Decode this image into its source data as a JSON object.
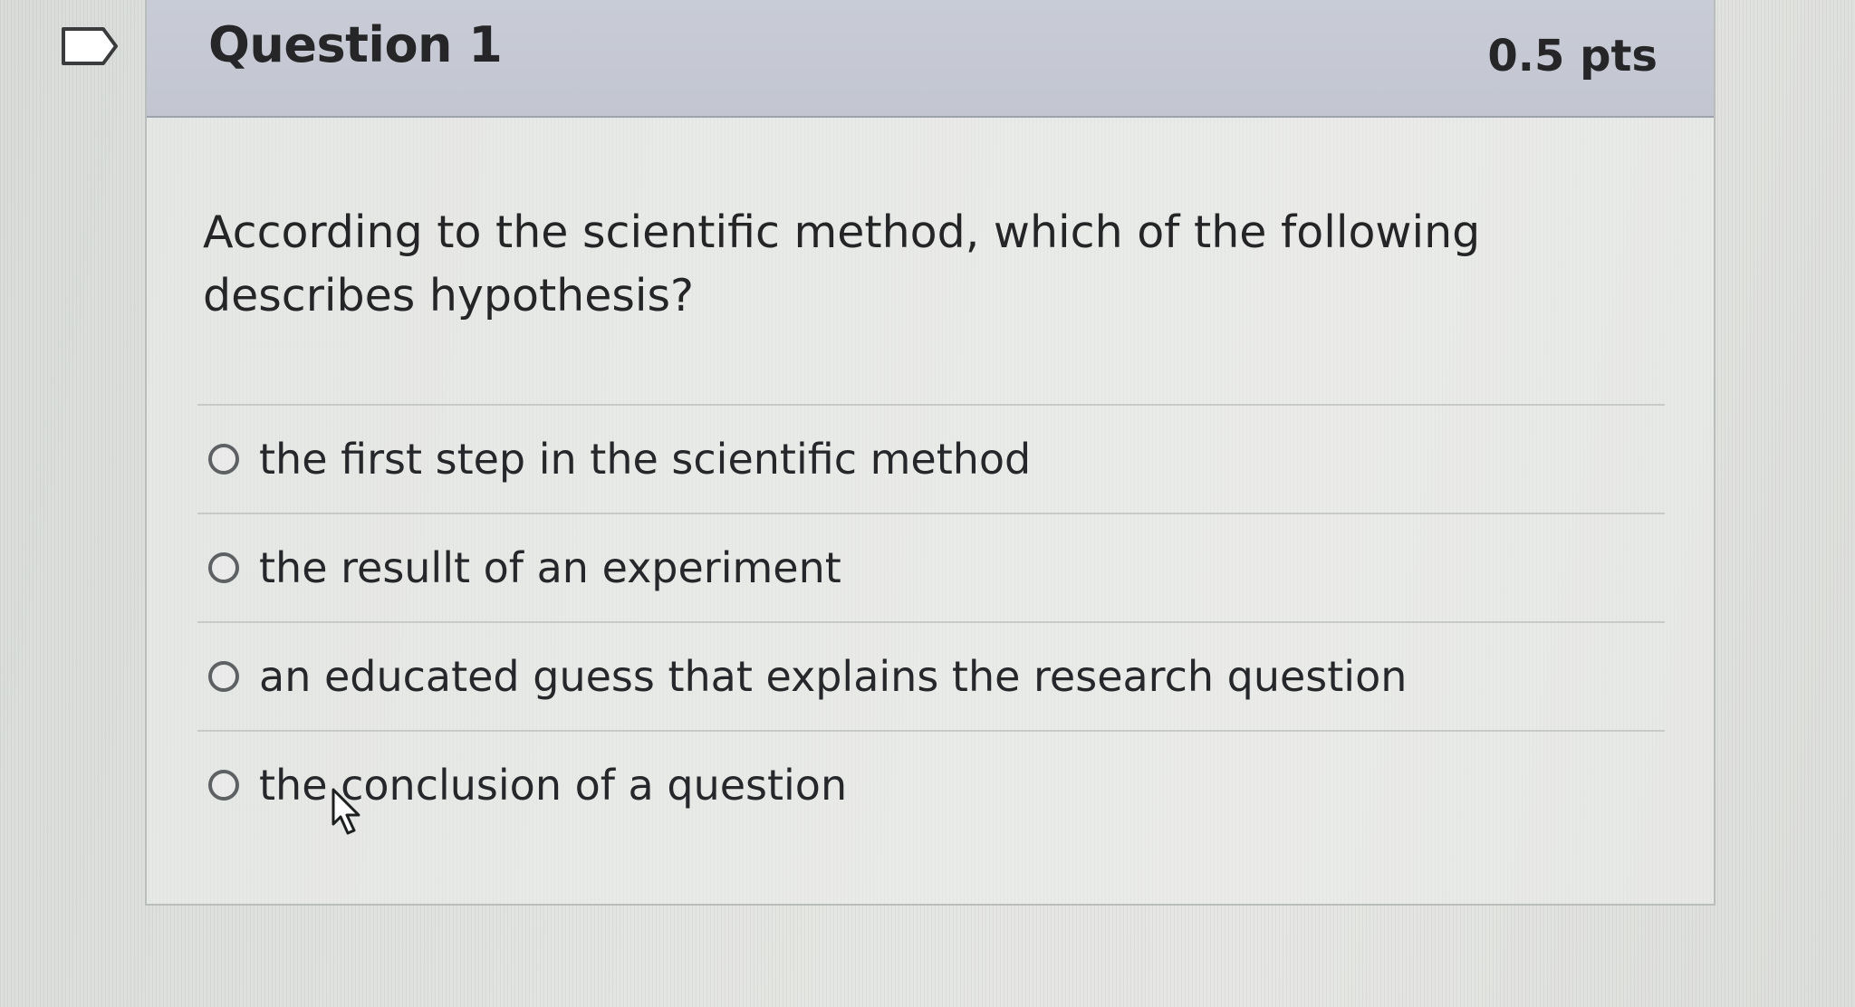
{
  "question": {
    "title": "Question 1",
    "points": "0.5 pts",
    "text": "According to the scientific method, which of the following describes hypothesis?",
    "answers": [
      {
        "label": "the first step in the scientific method",
        "selected": false
      },
      {
        "label": "the resullt of an experiment",
        "selected": false
      },
      {
        "label": "an educated guess that explains the research question",
        "selected": false
      },
      {
        "label": "the conclusion of a question",
        "selected": false
      }
    ]
  },
  "icons": {
    "flag": "flag-icon",
    "cursor": "hand-pointer-icon",
    "radio": "radio-button-icon"
  },
  "colors": {
    "header_bg": "#c6c9d4",
    "text": "#26272a",
    "border": "#b9bdbb"
  }
}
